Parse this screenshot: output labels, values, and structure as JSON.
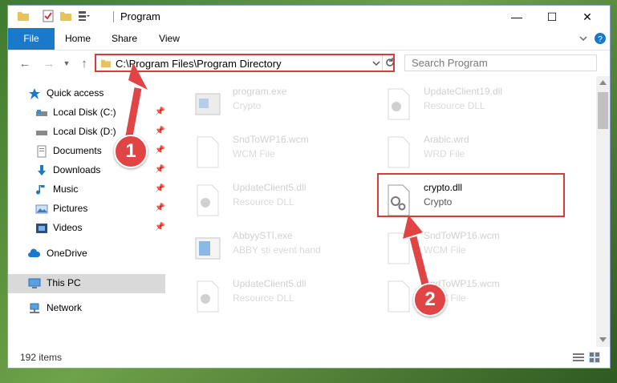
{
  "window": {
    "title": "Program",
    "controls": {
      "minimize": "—",
      "maximize": "☐",
      "close": "✕"
    }
  },
  "ribbon": {
    "tabs": [
      "File",
      "Home",
      "Share",
      "View"
    ]
  },
  "navigation": {
    "address": "C:\\Program Files\\Program Directory",
    "search_placeholder": "Search Program"
  },
  "sidebar": {
    "quick_access": "Quick access",
    "items": [
      {
        "label": "Local Disk (C:)",
        "icon": "local-disk-icon"
      },
      {
        "label": "Local Disk (D:)",
        "icon": "local-disk-icon"
      },
      {
        "label": "Documents",
        "icon": "documents-icon"
      },
      {
        "label": "Downloads",
        "icon": "downloads-icon"
      },
      {
        "label": "Music",
        "icon": "music-icon"
      },
      {
        "label": "Pictures",
        "icon": "pictures-icon"
      },
      {
        "label": "Videos",
        "icon": "videos-icon"
      }
    ],
    "onedrive": "OneDrive",
    "this_pc": "This PC",
    "network": "Network"
  },
  "files": [
    {
      "name": "program.exe",
      "type": "Crypto"
    },
    {
      "name": "UpdateClient19.dll",
      "type": "Resource DLL"
    },
    {
      "name": "SndToWP16.wcm",
      "type": "WCM File"
    },
    {
      "name": "Arabic.wrd",
      "type": "WRD File"
    },
    {
      "name": "UpdateClient5.dll",
      "type": "Resource DLL"
    },
    {
      "name": "crypto.dll",
      "type": "Crypto"
    },
    {
      "name": "AbbyySTI.exe",
      "type": "ABBY sti event hand"
    },
    {
      "name": "SndToWP16.wcm",
      "type": "WCM File"
    },
    {
      "name": "UpdateClient5.dll",
      "type": "Resource DLL"
    },
    {
      "name": "SndToWP15.wcm",
      "type": "WCM File"
    }
  ],
  "status": {
    "items_count": "192 items"
  },
  "callouts": [
    "1",
    "2"
  ],
  "colors": {
    "accent": "#1979ca",
    "highlight": "#d83b3b"
  }
}
